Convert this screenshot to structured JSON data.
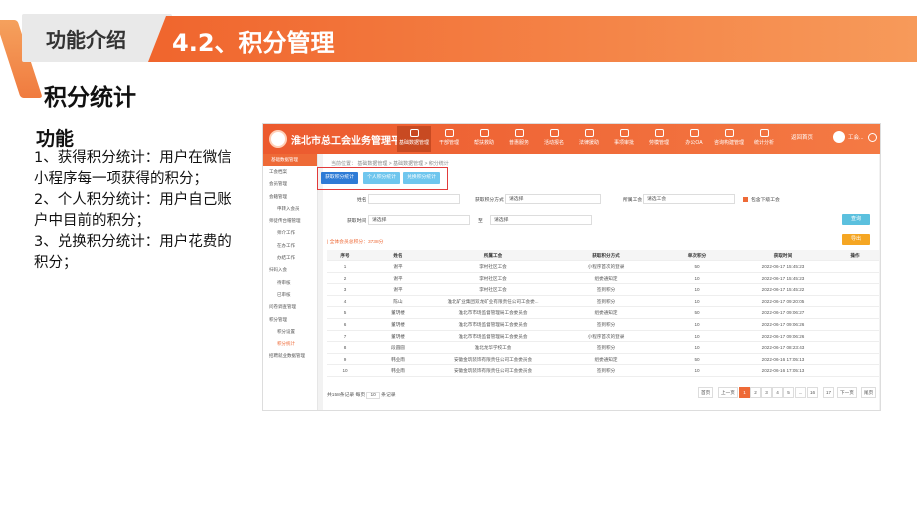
{
  "slide": {
    "header_left": "功能介绍",
    "header_right": "4.2、积分管理",
    "section_title": "积分统计",
    "feature_title": "功能",
    "feature_lines": [
      "1、获得积分统计：用户在微信小程序每一项获得的积分；",
      "2、个人积分统计：用户自己账户中目前的积分；",
      "3、兑换积分统计：用户花费的积分；"
    ]
  },
  "app": {
    "title": "淮北市总工会业务管理平台",
    "nav": [
      "基础数据管理",
      "干部管理",
      "帮扶救助",
      "普惠服务",
      "活动报名",
      "法律援助",
      "事项审批",
      "劳模管理",
      "办公OA",
      "咨询构建管理",
      "统计分析"
    ],
    "top_right": "返回首页",
    "user": "工会...",
    "sidebar": {
      "head": "基础数据管理",
      "items": [
        {
          "label": "工会档案",
          "sub": false,
          "on": false
        },
        {
          "label": "会员管理",
          "sub": false,
          "on": false
        },
        {
          "label": "会籍管理",
          "sub": false,
          "on": false
        },
        {
          "label": "申转入会员",
          "sub": true,
          "on": false
        },
        {
          "label": "师徒传台帽管理",
          "sub": false,
          "on": false
        },
        {
          "label": "师介工作",
          "sub": true,
          "on": false
        },
        {
          "label": "在办工作",
          "sub": true,
          "on": false
        },
        {
          "label": "办结工作",
          "sub": true,
          "on": false
        },
        {
          "label": "扫码入会",
          "sub": false,
          "on": false
        },
        {
          "label": "待审核",
          "sub": true,
          "on": false
        },
        {
          "label": "已审核",
          "sub": true,
          "on": false
        },
        {
          "label": "问卷调查管理",
          "sub": false,
          "on": false
        },
        {
          "label": "积分管理",
          "sub": false,
          "on": false
        },
        {
          "label": "积分设置",
          "sub": true,
          "on": false
        },
        {
          "label": "积分统计",
          "sub": true,
          "on": true
        },
        {
          "label": "招聘就业数据管理",
          "sub": false,
          "on": false
        }
      ]
    },
    "breadcrumb": "当前位置：  基础数据管理 > 基础数据管理 > 积分统计",
    "tabs": [
      "获取积分统计",
      "个人积分统计",
      "兑换积分统计"
    ],
    "filters": {
      "name_label": "姓名",
      "method_label": "获取积分方式",
      "method_value": "请选择",
      "union_label": "所属工会",
      "union_value": "请选工会",
      "include_sub": "包含下级工会",
      "time_label": "获取时间",
      "start_value": "请选择",
      "to": "至",
      "end_value": "请选择",
      "search": "查询",
      "export": "导出"
    },
    "total_label": "| 全体会员总积分：3738分",
    "table": {
      "headers": [
        "序号",
        "姓名",
        "所属工会",
        "获取积分方式",
        "单次积分",
        "获取时间",
        "操作"
      ],
      "rows": [
        [
          "1",
          "谢平",
          "李村社区工会",
          "小程序首次的登录",
          "50",
          "2022-06-17 15:45:23",
          ""
        ],
        [
          "2",
          "谢平",
          "李村社区工会",
          "组委通知定",
          "10",
          "2022-06-17 15:45:23",
          ""
        ],
        [
          "3",
          "谢平",
          "李村社区工会",
          "签到积分",
          "10",
          "2022-06-17 15:45:22",
          ""
        ],
        [
          "4",
          "陈山",
          "淮北矿业集团双龙矿业有限责任公司工会委...",
          "签到积分",
          "10",
          "2022-06-17 09:20:05",
          ""
        ],
        [
          "5",
          "董玥楼",
          "淮北市市场监督管理局工会委员会",
          "组委通知定",
          "50",
          "2022-06-17 09:06:27",
          ""
        ],
        [
          "6",
          "董玥楼",
          "淮北市市场监督管理局工会委员会",
          "签到积分",
          "10",
          "2022-06-17 09:06:26",
          ""
        ],
        [
          "7",
          "董玥楼",
          "淮北市市场监督管理局工会委员会",
          "小程序首次的登录",
          "10",
          "2022-06-17 09:06:26",
          ""
        ],
        [
          "8",
          "段圆圆",
          "淮北龙华学校工会",
          "签到积分",
          "10",
          "2022-06-17 08:23:43",
          ""
        ],
        [
          "9",
          "韩业雨",
          "安徽金筑装饰有限责任公司工会委员会",
          "组委通知定",
          "50",
          "2022-06-16 17:05:13",
          ""
        ],
        [
          "10",
          "韩业雨",
          "安徽金筑装饰有限责任公司工会委员会",
          "签到积分",
          "10",
          "2022-06-16 17:05:13",
          ""
        ]
      ]
    },
    "pager": {
      "info_a": "共158条记录  每页",
      "size": "10",
      "info_b": "条记录",
      "buttons": [
        "首页",
        "上一页",
        "1",
        "2",
        "3",
        "4",
        "5",
        "...",
        "16",
        "17",
        "下一页",
        "尾页"
      ]
    }
  }
}
